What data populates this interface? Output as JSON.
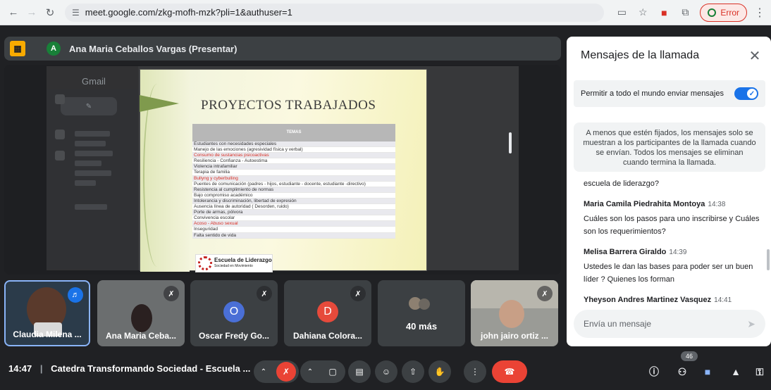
{
  "browser": {
    "url": "meet.google.com/zkg-mofh-mzk?pli=1&authuser=1",
    "error_label": "Error",
    "icons": [
      "back-icon",
      "forward-icon",
      "reload-icon",
      "site-info-icon",
      "cast-icon",
      "star-icon",
      "pdf-icon",
      "extensions-icon",
      "menu-icon"
    ]
  },
  "presenter": {
    "initial": "A",
    "label": "Ana Maria Ceballos Vargas (Presentar)"
  },
  "shared_screen": {
    "gmail_label": "Gmail",
    "slide": {
      "title": "PROYECTOS TRABAJADOS",
      "table_header": "TEMAS",
      "rows": [
        {
          "text": "Estudiantes con necesidades especiales",
          "red": false
        },
        {
          "text": "Manejo de las emociones (agresividad física y verbal)",
          "red": false
        },
        {
          "text": "Consumo de sustancias psicoactivas",
          "red": true
        },
        {
          "text": "Resiliencia - Confianza - Autoestima",
          "red": false
        },
        {
          "text": "Violencia intrafamiliar",
          "red": false
        },
        {
          "text": "Terapia de familia",
          "red": false
        },
        {
          "text": "Bullyng y cyberbulling",
          "red": true
        },
        {
          "text": "Puentes de comunicación (padres - hijos, estudiante - docente, estudiante -directivo)",
          "red": false
        },
        {
          "text": "Resistencia al cumplimiento de normas",
          "red": false
        },
        {
          "text": "Bajo compromiso académico",
          "red": false
        },
        {
          "text": "Intolerancia y discriminación, libertad de expresión",
          "red": false
        },
        {
          "text": "Ausencia línea de autoridad ( Desorden, ruido)",
          "red": false
        },
        {
          "text": "Porte de armas, pólvora",
          "red": false
        },
        {
          "text": "Convivencia escolar",
          "red": false
        },
        {
          "text": "Acoso - Abuso sexual",
          "red": true
        },
        {
          "text": "Inseguridad",
          "red": false
        },
        {
          "text": "Falta sentido de vida",
          "red": false
        }
      ],
      "logo_text": "Escuela de Liderazgo",
      "logo_sub": "Sociedad en Movimiento"
    }
  },
  "tiles": [
    {
      "name": "Claudia Milena ...",
      "type": "video",
      "speaking": true
    },
    {
      "name": "Ana Maria Ceba...",
      "type": "video",
      "muted": true
    },
    {
      "name": "Oscar Fredy Go...",
      "type": "avatar",
      "initial": "O",
      "color": "#4a6fd6",
      "muted": true
    },
    {
      "name": "Dahiana Colora...",
      "type": "avatar",
      "initial": "D",
      "color": "#e64a3b",
      "muted": true
    },
    {
      "name": "40 más",
      "type": "more"
    },
    {
      "name": "john jairo ortiz ...",
      "type": "video",
      "muted": true
    }
  ],
  "chat": {
    "title": "Mensajes de la llamada",
    "permission_label": "Permitir a todo el mundo enviar mensajes",
    "permission_on": true,
    "notice": "A menos que estén fijados, los mensajes solo se muestran a los participantes de la llamada cuando se envían. Todos los mensajes se eliminan cuando termina la llamada.",
    "messages": [
      {
        "author": "",
        "time": "",
        "text": "escuela de liderazgo?"
      },
      {
        "author": "Maria Camila Piedrahita Montoya",
        "time": "14:38",
        "text": "Cuáles son los pasos para uno inscribirse y Cuáles son los requerimientos?"
      },
      {
        "author": "Melisa Barrera Giraldo",
        "time": "14:39",
        "text": "Ustedes le dan las bases para poder ser un buen líder ? Quienes los forman"
      },
      {
        "author": "Yheyson Andres Martinez Vasquez",
        "time": "14:41",
        "text": ""
      }
    ],
    "input_placeholder": "Envía un mensaje"
  },
  "bottom_bar": {
    "time": "14:47",
    "meeting_title": "Catedra Transformando Sociedad - Escuela ...",
    "participants_count": "46",
    "controls": [
      "mic-off",
      "camera",
      "captions",
      "emoji",
      "present",
      "raise-hand",
      "more-options",
      "end-call"
    ],
    "right_icons": [
      "info-icon",
      "people-icon",
      "chat-icon",
      "activities-icon",
      "host-controls-icon"
    ]
  }
}
